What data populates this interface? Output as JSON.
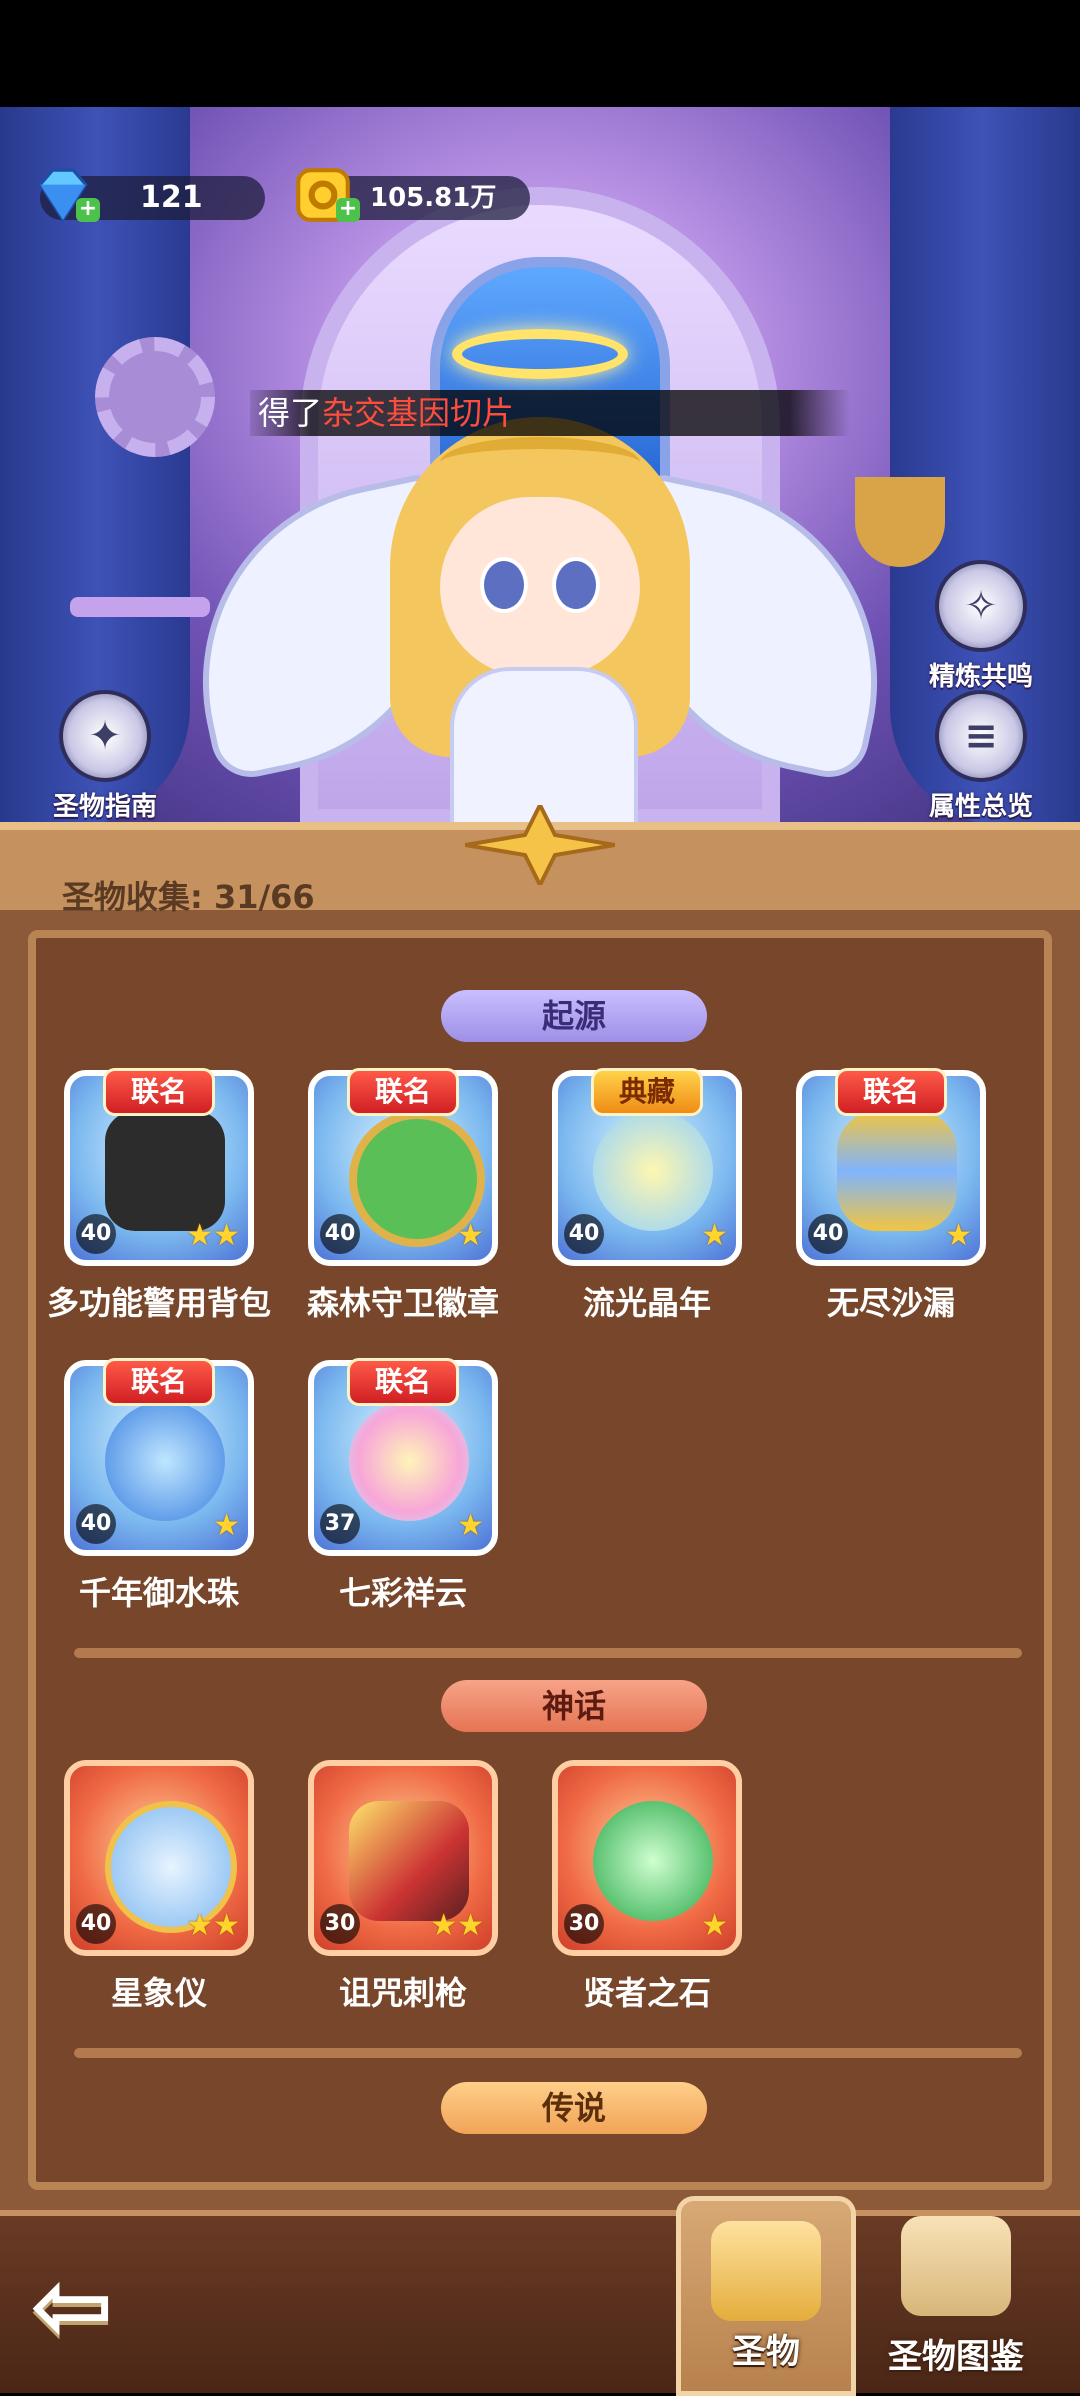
{
  "currency": {
    "gems": "121",
    "gold": "105.81万"
  },
  "notice": {
    "prefix": "得了",
    "item": "杂交基因切片"
  },
  "side_buttons": {
    "guide": "圣物指南",
    "resonance": "精炼共鸣",
    "attributes": "属性总览"
  },
  "panel": {
    "collection_label": "圣物收集: 31/66"
  },
  "categories": {
    "origin": {
      "label": "起源",
      "items": [
        {
          "name": "多功能警用背包",
          "badge": "联名",
          "level": "40",
          "stars": "★★"
        },
        {
          "name": "森林守卫徽章",
          "badge": "联名",
          "level": "40",
          "stars": "★"
        },
        {
          "name": "流光晶年",
          "badge": "典藏",
          "level": "40",
          "stars": "★"
        },
        {
          "name": "无尽沙漏",
          "badge": "联名",
          "level": "40",
          "stars": "★"
        },
        {
          "name": "千年御水珠",
          "badge": "联名",
          "level": "40",
          "stars": "★"
        },
        {
          "name": "七彩祥云",
          "badge": "联名",
          "level": "37",
          "stars": "★"
        }
      ]
    },
    "myth": {
      "label": "神话",
      "items": [
        {
          "name": "星象仪",
          "level": "40",
          "stars": "★★"
        },
        {
          "name": "诅咒刺枪",
          "level": "30",
          "stars": "★★"
        },
        {
          "name": "贤者之石",
          "level": "30",
          "stars": "★"
        }
      ]
    },
    "legend": {
      "label": "传说"
    }
  },
  "bottom_tabs": {
    "relics": "圣物",
    "codex": "圣物图鉴"
  },
  "colors": {
    "panel_bg": "#8c5a38",
    "badge_red": "#d01f24",
    "badge_gold": "#f08c16",
    "star": "#ffd42d",
    "notice_highlight": "#ff4d3d"
  }
}
